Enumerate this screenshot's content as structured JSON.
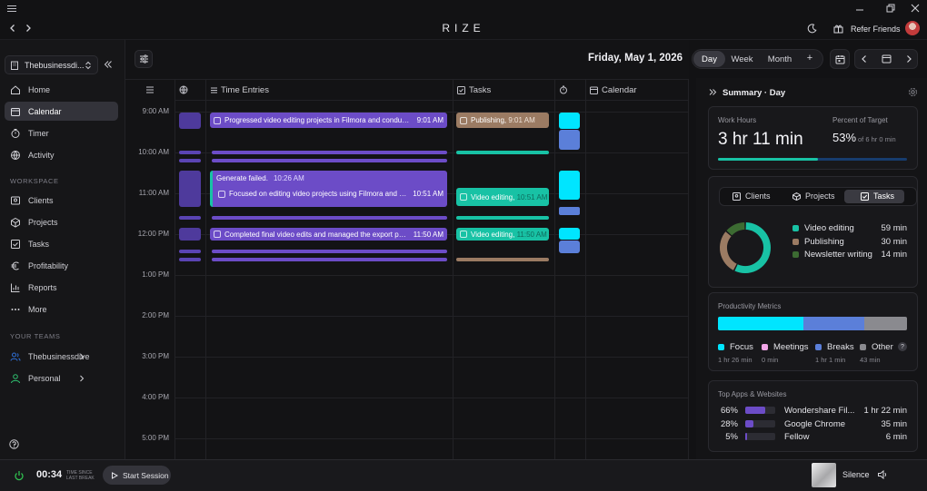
{
  "app": {
    "brand": "RIZE",
    "refer_label": "Refer Friends"
  },
  "header": {
    "date": "Friday, May 1, 2026",
    "views": [
      "Day",
      "Week",
      "Month"
    ],
    "active_view": "Day",
    "add": "+"
  },
  "sidebar": {
    "workspace": "Thebusinessdi...",
    "nav": [
      {
        "label": "Home",
        "icon": "home-icon"
      },
      {
        "label": "Calendar",
        "icon": "calendar-icon",
        "active": true
      },
      {
        "label": "Timer",
        "icon": "timer-icon"
      },
      {
        "label": "Activity",
        "icon": "activity-icon"
      }
    ],
    "workspace_title": "WORKSPACE",
    "workspace_nav": [
      {
        "label": "Clients",
        "icon": "clients-icon"
      },
      {
        "label": "Projects",
        "icon": "projects-icon"
      },
      {
        "label": "Tasks",
        "icon": "tasks-icon"
      },
      {
        "label": "Profitability",
        "icon": "euro-icon"
      },
      {
        "label": "Reports",
        "icon": "reports-icon"
      },
      {
        "label": "More",
        "icon": "more-icon"
      }
    ],
    "teams_title": "YOUR TEAMS",
    "teams": [
      {
        "label": "Thebusinessdive",
        "color": "#2f6fd6"
      },
      {
        "label": "Personal",
        "color": "#2fbf6f"
      }
    ]
  },
  "columns": {
    "time_entries": "Time Entries",
    "tasks": "Tasks",
    "calendar": "Calendar"
  },
  "time_labels": [
    "9:00 AM",
    "10:00 AM",
    "11:00 AM",
    "12:00 PM",
    "1:00 PM",
    "2:00 PM",
    "3:00 PM",
    "4:00 PM",
    "5:00 PM"
  ],
  "entries": [
    {
      "text": "Progressed video editing projects in Filmora and conducte...",
      "time": "9:01 AM"
    },
    {
      "text": "Generate failed.",
      "time": "10:26 AM"
    },
    {
      "text": "Focused on editing video projects using Filmora and briefl...",
      "time": "10:51 AM"
    },
    {
      "text": "Completed final video edits and managed the export proc...",
      "time": "11:50 AM"
    }
  ],
  "task_entries": [
    {
      "text": "Publishing",
      "time": "9:01 AM"
    },
    {
      "text": "Video editing",
      "time": "10:51 AM"
    },
    {
      "text": "Video editing",
      "time": "11:50 AM"
    }
  ],
  "summary": {
    "title": "Summary · Day",
    "work_hours_label": "Work Hours",
    "work_hours_value": "3 hr 11 min",
    "percent_label": "Percent of Target",
    "percent_value": "53%",
    "percent_of": "of 6 hr 0 min",
    "target_progress": 0.53,
    "tabs": [
      "Clients",
      "Projects",
      "Tasks"
    ],
    "active_tab": "Tasks",
    "donut": [
      {
        "label": "Video editing",
        "value": "59 min",
        "minutes": 59,
        "color": "#18c2a5"
      },
      {
        "label": "Publishing",
        "value": "30 min",
        "minutes": 30,
        "color": "#9b7b63"
      },
      {
        "label": "Newsletter writing",
        "value": "14 min",
        "minutes": 14,
        "color": "#3c6b32"
      }
    ],
    "productivity_title": "Productivity Metrics",
    "productivity": [
      {
        "label": "Focus",
        "value": "1 hr 26 min",
        "minutes": 86,
        "color": "#00e5ff"
      },
      {
        "label": "Meetings",
        "value": "0 min",
        "minutes": 0,
        "color": "#f2a6e8"
      },
      {
        "label": "Breaks",
        "value": "1 hr 1 min",
        "minutes": 61,
        "color": "#5b7fd9"
      },
      {
        "label": "Other",
        "value": "43 min",
        "minutes": 43,
        "color": "#8a8a8f"
      }
    ],
    "help": "?",
    "apps_title": "Top Apps & Websites",
    "apps": [
      {
        "pct": "66%",
        "fraction": 0.66,
        "name": "Wondershare Fil...",
        "time": "1 hr 22 min"
      },
      {
        "pct": "28%",
        "fraction": 0.28,
        "name": "Google Chrome",
        "time": "35 min"
      },
      {
        "pct": "5%",
        "fraction": 0.05,
        "name": "Fellow",
        "time": "6 min"
      }
    ]
  },
  "bottom": {
    "timer": "00:34",
    "timer_caption_1": "TIME SINCE",
    "timer_caption_2": "LAST BREAK",
    "start_session": "Start Session",
    "sound": "Silence"
  },
  "colors": {
    "accent": "#00e5ff",
    "entry": "#6c4cc7",
    "task_green": "#18c2a5",
    "task_brown": "#9b7b63",
    "break": "#5b7fd9"
  }
}
